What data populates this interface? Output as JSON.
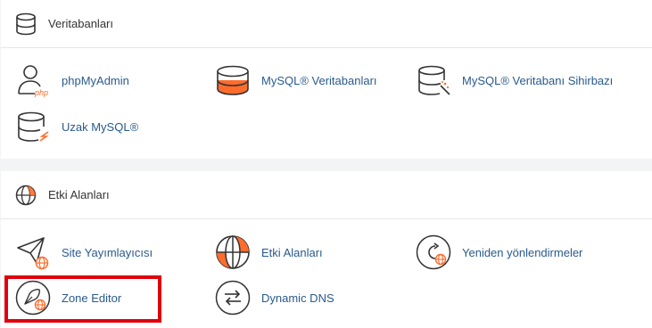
{
  "colors": {
    "accent": "#ff6c2c",
    "link": "#295a8d",
    "highlight": "#e0000c"
  },
  "databases": {
    "title": "Veritabanları",
    "icon": "database-icon",
    "items": [
      {
        "label": "phpMyAdmin",
        "icon": "phpmyadmin-icon"
      },
      {
        "label": "MySQL® Veritabanları",
        "icon": "mysql-databases-icon"
      },
      {
        "label": "MySQL® Veritabanı Sihirbazı",
        "icon": "mysql-wizard-icon"
      },
      {
        "label": "Uzak MySQL®",
        "icon": "remote-mysql-icon"
      }
    ]
  },
  "domains": {
    "title": "Etki Alanları",
    "icon": "globe-icon",
    "items": [
      {
        "label": "Site Yayımlayıcısı",
        "icon": "site-publisher-icon"
      },
      {
        "label": "Etki Alanları",
        "icon": "domains-icon"
      },
      {
        "label": "Yeniden yönlendirmeler",
        "icon": "redirects-icon"
      },
      {
        "label": "Zone Editor",
        "icon": "zone-editor-icon"
      },
      {
        "label": "Dynamic DNS",
        "icon": "dynamic-dns-icon"
      }
    ]
  }
}
